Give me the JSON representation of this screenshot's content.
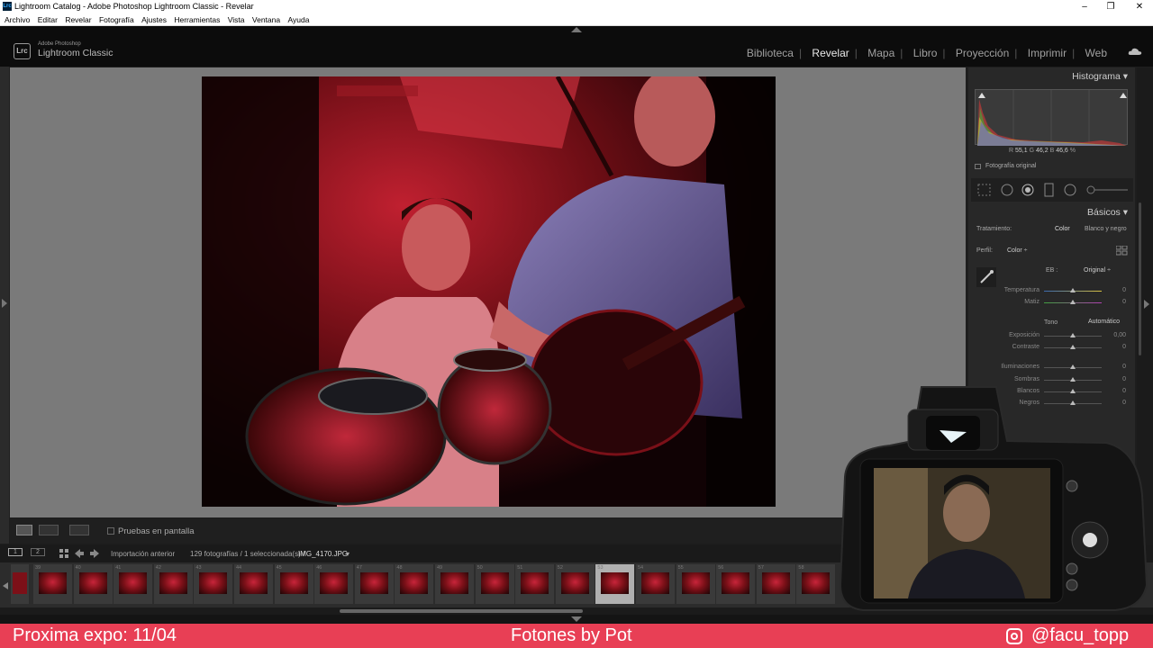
{
  "window": {
    "title": "Lightroom Catalog - Adobe Photoshop Lightroom Classic - Revelar",
    "app_icon": "Lrc",
    "controls": [
      "–",
      "❐",
      "✕"
    ]
  },
  "menubar": [
    "Archivo",
    "Editar",
    "Revelar",
    "Fotografía",
    "Ajustes",
    "Herramientas",
    "Vista",
    "Ventana",
    "Ayuda"
  ],
  "brand": {
    "logo": "Lrc",
    "top": "Adobe Photoshop",
    "main": "Lightroom Classic"
  },
  "modules": {
    "items": [
      "Biblioteca",
      "Revelar",
      "Mapa",
      "Libro",
      "Proyección",
      "Imprimir",
      "Web"
    ],
    "active": "Revelar"
  },
  "toolbar": {
    "proof_label": "Pruebas en pantalla",
    "proof_checked": false
  },
  "right_panel": {
    "histogram": {
      "title": "Histograma",
      "readout": {
        "r_label": "R",
        "r_value": "55,1",
        "g_label": "G",
        "g_value": "46,2",
        "b_label": "B",
        "b_value": "46,6",
        "unit": "%"
      },
      "original_label": "Fotografía original"
    },
    "basics": {
      "title": "Básicos",
      "treatment_label": "Tratamiento:",
      "treatment_color": "Color",
      "treatment_bw": "Blanco y negro",
      "profile_label": "Perfil:",
      "profile_value": "Color ÷",
      "wb_label": "EB :",
      "wb_value": "Original ÷",
      "tone_label": "Tono",
      "auto_label": "Automático",
      "sliders": [
        {
          "label": "Temperatura",
          "value": "0"
        },
        {
          "label": "Matiz",
          "value": "0"
        },
        {
          "label": "Exposición",
          "value": "0,00"
        },
        {
          "label": "Contraste",
          "value": "0"
        },
        {
          "label": "Iluminaciones",
          "value": "0"
        },
        {
          "label": "Sombras",
          "value": "0"
        },
        {
          "label": "Blancos",
          "value": "0"
        },
        {
          "label": "Negros",
          "value": "0"
        }
      ]
    }
  },
  "filmstrip_bar": {
    "view1": "1",
    "view2": "2",
    "source": "Importación anterior",
    "count": "129 fotografías / 1 seleccionada(s) /",
    "filename": "IMG_4170.JPG",
    "filename_arrow": "▾"
  },
  "filmstrip": {
    "numbers": [
      "39",
      "40",
      "41",
      "42",
      "43",
      "44",
      "45",
      "46",
      "47",
      "48",
      "49",
      "50",
      "51",
      "52",
      "53",
      "54",
      "55",
      "56",
      "57",
      "58"
    ],
    "selected_index": 14
  },
  "overlay": {
    "left_text": "Proxima expo: 11/04",
    "center_text": "Fotones by Pot",
    "right_text": "@facu_topp",
    "banner_color": "#e83f55"
  }
}
